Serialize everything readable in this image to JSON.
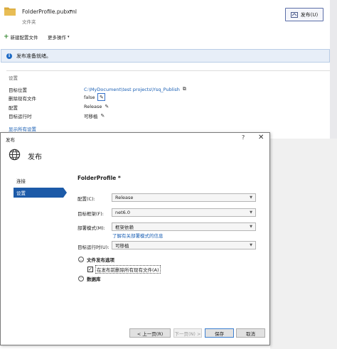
{
  "header": {
    "profile_name": "FolderProfile.pubxml",
    "profile_caret": "▾",
    "profile_type": "文件夹",
    "publish_button": "发布(U)"
  },
  "toolbar": {
    "new_profile": "新建配置文件",
    "more_actions": "更多操作",
    "more_caret": "▾"
  },
  "info_bar": {
    "message": "发布准备就绪。"
  },
  "settings": {
    "section_title": "设置",
    "rows": [
      {
        "label": "目标位置",
        "value": "C:\\MyDocument\\test projects\\Ysq_Publish"
      },
      {
        "label": "删除现有文件",
        "value": "false"
      },
      {
        "label": "配置",
        "value": "Release"
      },
      {
        "label": "目标运行时",
        "value": "可移植"
      }
    ],
    "show_all": "显示所有设置"
  },
  "dialog": {
    "title": "发布",
    "help": "?",
    "close": "✕",
    "heading": "发布",
    "nav": [
      {
        "label": "连接",
        "active": false
      },
      {
        "label": "设置",
        "active": true
      }
    ],
    "profile_title": "FolderProfile *",
    "fields": {
      "configuration": {
        "label": "配置(C):",
        "value": "Release"
      },
      "framework": {
        "label": "目标框架(F):",
        "value": "net6.0"
      },
      "deployment": {
        "label": "部署模式(M):",
        "value": "框架依赖"
      },
      "runtime": {
        "label": "目标运行时(U):",
        "value": "可移植"
      }
    },
    "deployment_link": "了解有关部署模式的信息",
    "file_publish_options": "文件发布选项",
    "delete_existing_checkbox": {
      "label": "在发布前删除所有现有文件(A)",
      "checked": true
    },
    "databases": "数据库",
    "buttons": {
      "prev": "< 上一页(R)",
      "next": "下一页(N) >",
      "save": "保存",
      "cancel": "取消"
    }
  },
  "colors": {
    "accent": "#1c5aa8",
    "link": "#1a5fb4",
    "info_bg": "#e7eef8",
    "folder": "#d9a93a"
  },
  "icons": {
    "folder": "folder-icon",
    "publish": "publish-icon",
    "plus": "plus-icon",
    "info": "info-icon",
    "copy": "copy-icon",
    "pencil": "pencil-icon",
    "globe": "globe-icon"
  }
}
